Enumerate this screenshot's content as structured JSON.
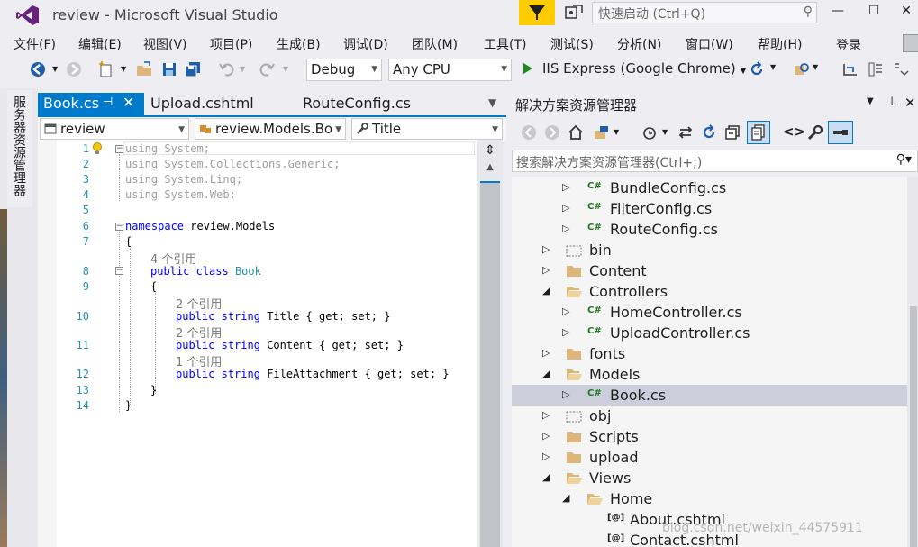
{
  "window": {
    "title": "review - Microsoft Visual Studio",
    "quick_launch_placeholder": "快速启动 (Ctrl+Q)",
    "controls": {
      "minimize": "—",
      "maximize": "☐",
      "close": "✕"
    }
  },
  "menu": {
    "items": [
      "文件(F)",
      "编辑(E)",
      "视图(V)",
      "项目(P)",
      "生成(B)",
      "调试(D)",
      "团队(M)",
      "工具(T)",
      "测试(S)",
      "分析(N)",
      "窗口(W)",
      "帮助(H)"
    ],
    "login": "登录"
  },
  "toolbar": {
    "config": "Debug",
    "platform": "Any CPU",
    "run_target": "IIS Express (Google Chrome)"
  },
  "left_rail": {
    "server_explorer": "服务器资源管理器"
  },
  "editor": {
    "tabs": [
      {
        "label": "Book.cs",
        "active": true
      },
      {
        "label": "Upload.cshtml",
        "active": false
      },
      {
        "label": "RouteConfig.cs",
        "active": false
      }
    ],
    "nav": {
      "project": "review",
      "type": "review.Models.Bo",
      "member": "Title"
    },
    "line_numbers": [
      "1",
      "2",
      "3",
      "4",
      "5",
      "6",
      "7",
      "8",
      "9",
      "10",
      "11",
      "12",
      "13",
      "14"
    ],
    "lines": {
      "l1": "System;",
      "l2": "System.Collections.Generic;",
      "l3": "System.Linq;",
      "l4": "System.Web;",
      "l6": "review.Models",
      "l7": "{",
      "l8_name": "Book",
      "l9": "{",
      "l10_name": "Title",
      "l11_name": "Content",
      "l12_name": "FileAttachment",
      "accessor": "{ get; set; }",
      "l13": "}",
      "l14": "}"
    },
    "keywords": {
      "using": "using",
      "namespace": "namespace",
      "public": "public",
      "class": "class",
      "string": "string"
    },
    "codelens": {
      "book": "4 个引用",
      "title": "2 个引用",
      "content": "2 个引用",
      "file": "1 个引用"
    }
  },
  "solution_explorer": {
    "title": "解决方案资源管理器",
    "search_placeholder": "搜索解决方案资源管理器(Ctrl+;)",
    "items": [
      {
        "label": "BundleConfig.cs",
        "kind": "cs"
      },
      {
        "label": "FilterConfig.cs",
        "kind": "cs"
      },
      {
        "label": "RouteConfig.cs",
        "kind": "cs"
      },
      {
        "label": "bin",
        "kind": "folder-hidden"
      },
      {
        "label": "Content",
        "kind": "folder"
      },
      {
        "label": "Controllers",
        "kind": "folder-open"
      },
      {
        "label": "HomeController.cs",
        "kind": "cs"
      },
      {
        "label": "UploadController.cs",
        "kind": "cs"
      },
      {
        "label": "fonts",
        "kind": "folder"
      },
      {
        "label": "Models",
        "kind": "folder-open"
      },
      {
        "label": "Book.cs",
        "kind": "cs",
        "selected": true
      },
      {
        "label": "obj",
        "kind": "folder-hidden"
      },
      {
        "label": "Scripts",
        "kind": "folder"
      },
      {
        "label": "upload",
        "kind": "folder"
      },
      {
        "label": "Views",
        "kind": "folder-open"
      },
      {
        "label": "Home",
        "kind": "folder-open"
      },
      {
        "label": "About.cshtml",
        "kind": "cshtml"
      },
      {
        "label": "Contact.cshtml",
        "kind": "cshtml"
      }
    ]
  },
  "watermark": "blog.csdn.net/weixin_44575911",
  "colors": {
    "accent": "#007acc",
    "feedback": "#ffcc00",
    "selection": "#cccedb",
    "folder": "#dcb67a"
  }
}
